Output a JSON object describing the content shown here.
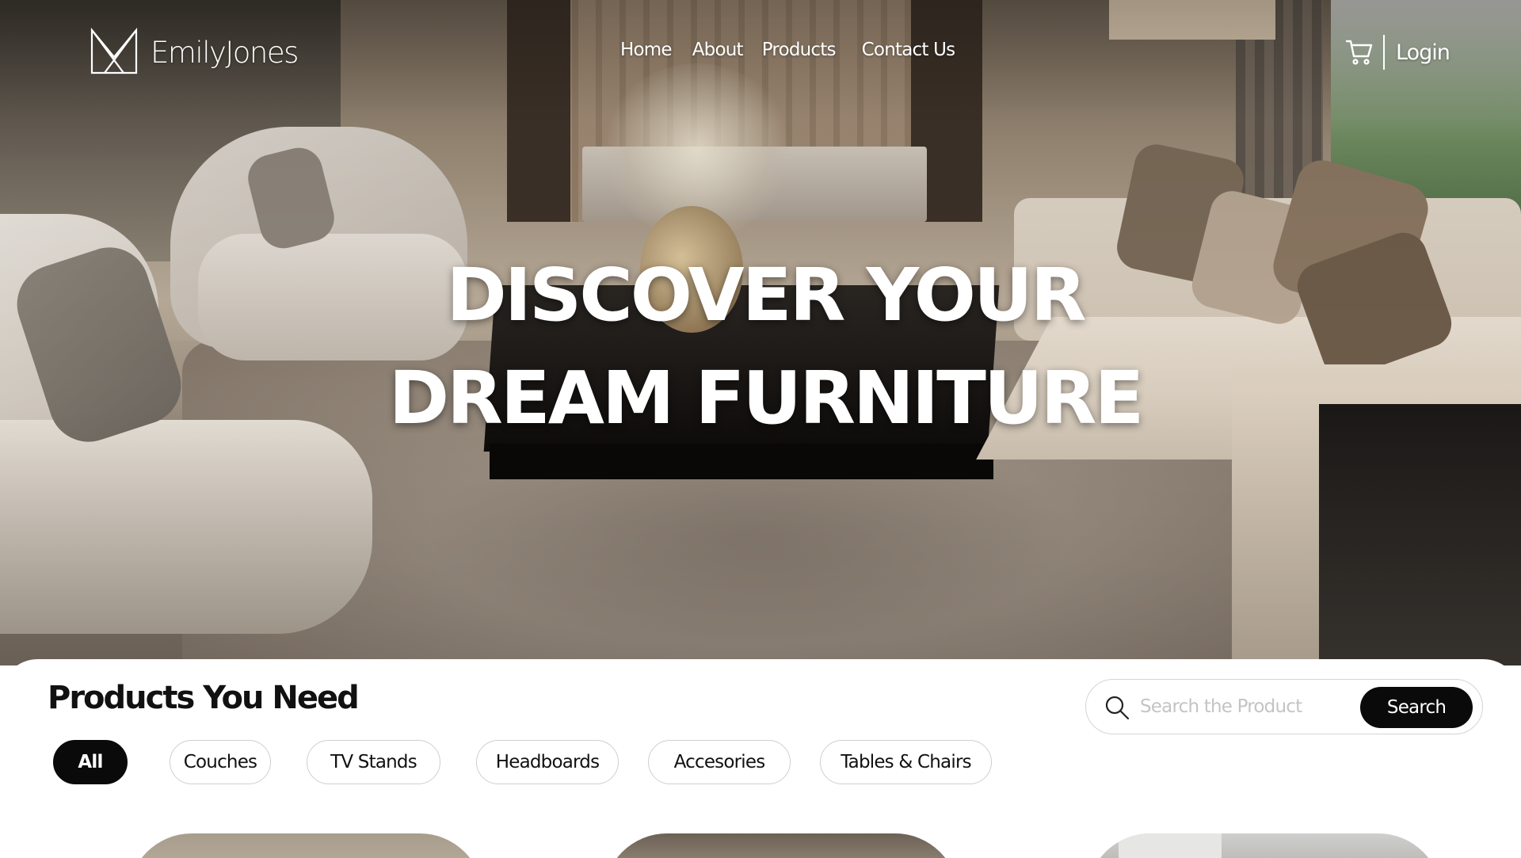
{
  "brand": {
    "name": "EmilyJones"
  },
  "nav": {
    "items": [
      "Home",
      "About",
      "Products",
      "Contact Us"
    ],
    "login_label": "Login",
    "cart_icon": "cart-icon"
  },
  "hero": {
    "headline_line1": "DISCOVER YOUR",
    "headline_line2": "DREAM FURNITURE"
  },
  "products": {
    "title": "Products You Need",
    "search": {
      "placeholder": "Search the Product",
      "value": "",
      "button_label": "Search",
      "icon": "search-icon"
    },
    "filters": [
      "All",
      "Couches",
      "TV Stands",
      "Headboards",
      "Accesories",
      "Tables & Chairs"
    ],
    "active_filter": "All"
  },
  "colors": {
    "accent": "#0a0a0a",
    "background": "#ffffff",
    "nav_text": "#ffffff"
  }
}
